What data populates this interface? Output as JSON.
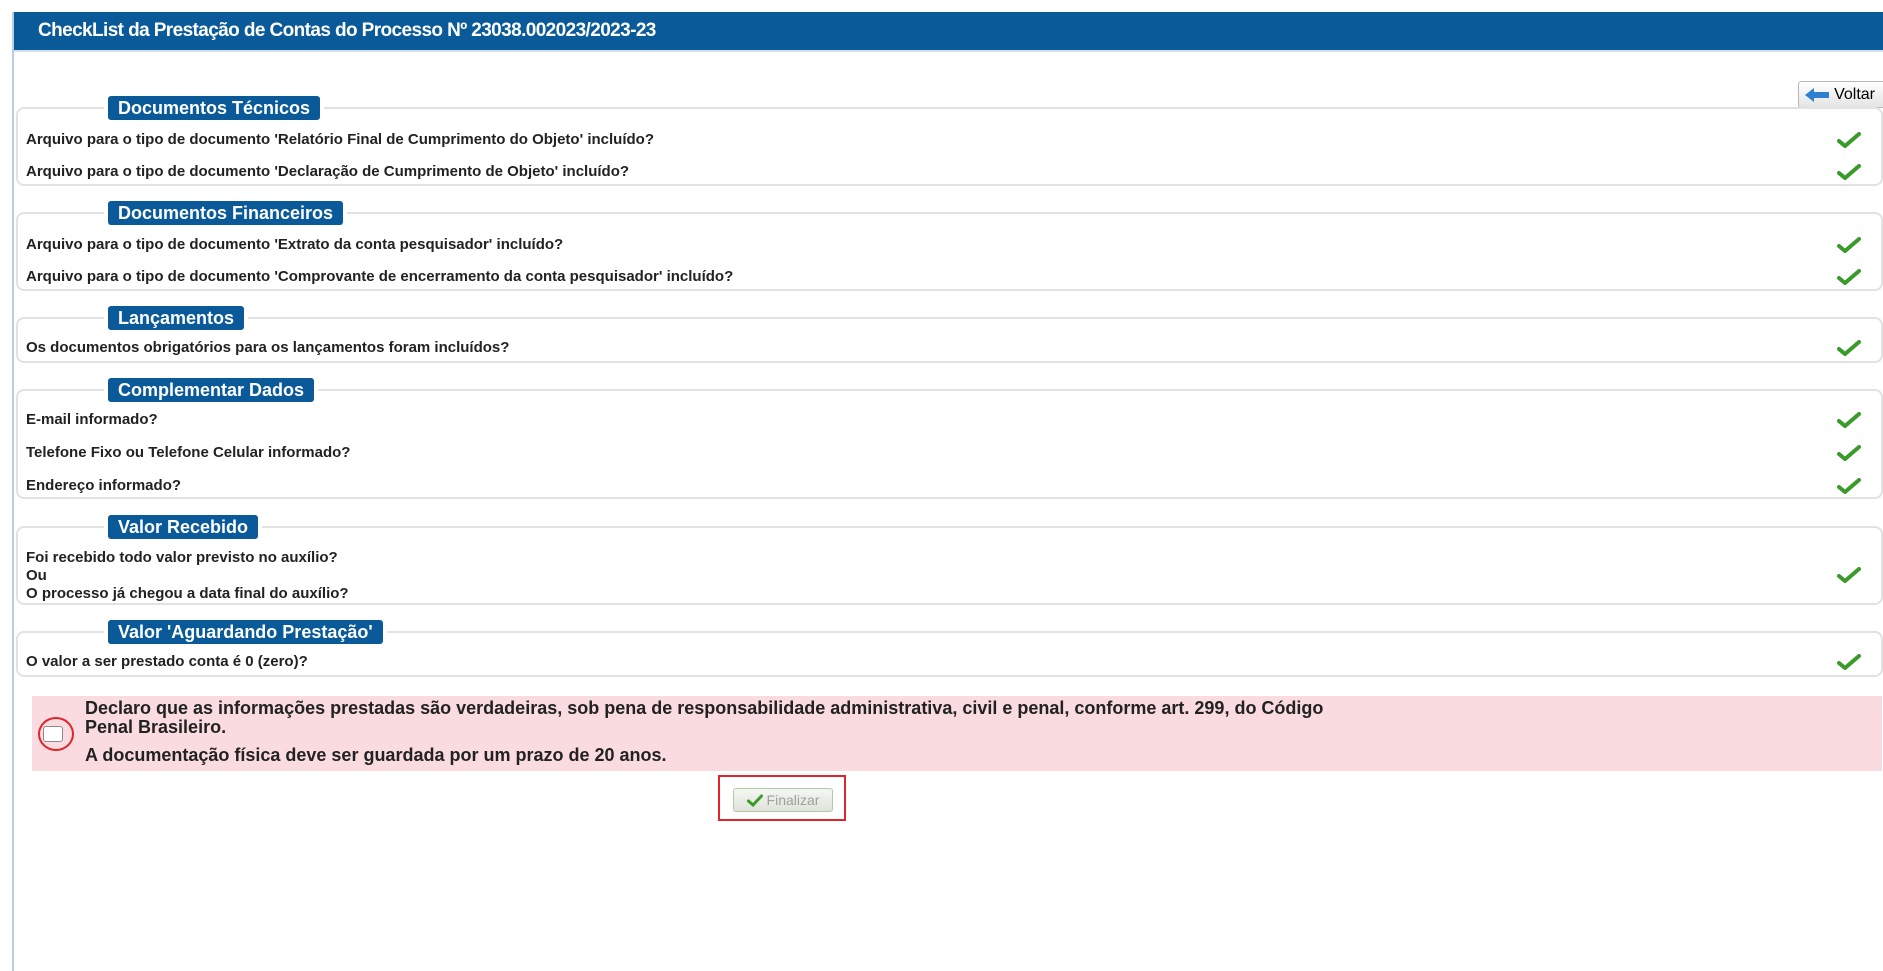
{
  "title": "CheckList da Prestação de Contas do Processo Nº 23038.002023/2023-23",
  "voltar_label": "Voltar",
  "sections": [
    {
      "legend": "Documentos Técnicos",
      "items": [
        "Arquivo para o tipo de documento 'Relatório Final de Cumprimento do Objeto' incluído?",
        "Arquivo para o tipo de documento 'Declaração de Cumprimento de Objeto' incluído?"
      ]
    },
    {
      "legend": "Documentos Financeiros",
      "items": [
        "Arquivo para o tipo de documento 'Extrato da conta pesquisador' incluído?",
        "Arquivo para o tipo de documento 'Comprovante de encerramento da conta pesquisador' incluído?"
      ]
    },
    {
      "legend": "Lançamentos",
      "items": [
        "Os documentos obrigatórios para os lançamentos foram incluídos?"
      ]
    },
    {
      "legend": "Complementar Dados",
      "items": [
        "E-mail informado?",
        "Telefone Fixo ou Telefone Celular informado?",
        "Endereço informado?"
      ]
    },
    {
      "legend": "Valor Recebido",
      "multiline": [
        "Foi recebido todo valor previsto no auxílio?",
        "Ou",
        "O processo já chegou a data final do auxílio?"
      ]
    },
    {
      "legend": "Valor 'Aguardando Prestação'",
      "items": [
        "O valor a ser prestado conta é 0 (zero)?"
      ]
    }
  ],
  "declaration": {
    "line1": "Declaro que as informações prestadas são verdadeiras, sob pena de responsabilidade administrativa, civil e penal, conforme art. 299, do Código",
    "line2": "Penal Brasileiro.",
    "line3": "A documentação física deve ser guardada por um prazo de 20 anos."
  },
  "finalizar_label": "Finalizar",
  "colors": {
    "header": "#0a5a99",
    "check": "#3a9a2a",
    "declaration_bg": "#f9dbe0",
    "highlight": "#e0242c"
  }
}
